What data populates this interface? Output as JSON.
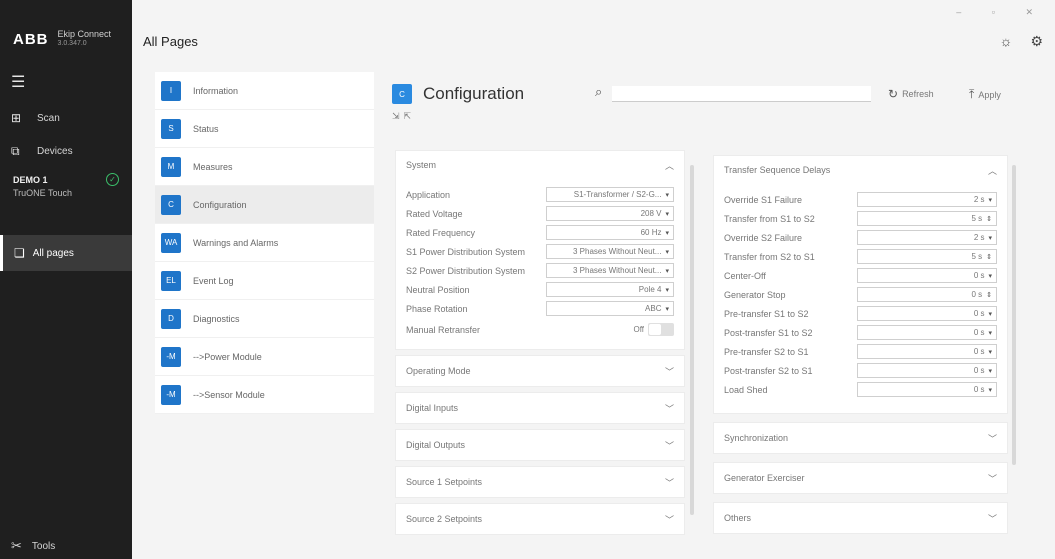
{
  "sidebar": {
    "brand": "ABB",
    "app_name": "Ekip Connect",
    "version": "3.0.347.0",
    "menu_icon": "hamburger-icon",
    "items": [
      {
        "label": "Scan",
        "icon": "scan-icon"
      },
      {
        "label": "Devices",
        "icon": "devices-icon"
      }
    ],
    "device": {
      "name": "DEMO 1",
      "model": "TruONE Touch",
      "status_icon": "check-circle-icon",
      "status_color": "#3bbf6a"
    },
    "active": {
      "label": "All pages",
      "icon": "pages-icon"
    },
    "tools": {
      "label": "Tools",
      "icon": "tools-icon"
    }
  },
  "header": {
    "title": "All Pages",
    "icons": [
      "lightbulb-icon",
      "gear-icon"
    ]
  },
  "pages": [
    {
      "badge": "I",
      "label": "Information"
    },
    {
      "badge": "S",
      "label": "Status"
    },
    {
      "badge": "M",
      "label": "Measures"
    },
    {
      "badge": "C",
      "label": "Configuration",
      "selected": true
    },
    {
      "badge": "WA",
      "label": "Warnings and Alarms"
    },
    {
      "badge": "EL",
      "label": "Event Log"
    },
    {
      "badge": "D",
      "label": "Diagnostics"
    },
    {
      "badge": "-M",
      "label": "-->Power Module"
    },
    {
      "badge": "-M",
      "label": "-->Sensor Module"
    }
  ],
  "config": {
    "badge": "C",
    "title": "Configuration",
    "search_placeholder": "",
    "refresh_label": "Refresh",
    "apply_label": "Apply",
    "accent": "#1f75c9"
  },
  "system": {
    "title": "System",
    "fields": [
      {
        "label": "Application",
        "value": "S1-Transformer / S2-G..."
      },
      {
        "label": "Rated Voltage",
        "value": "208 V"
      },
      {
        "label": "Rated Frequency",
        "value": "60 Hz"
      },
      {
        "label": "S1 Power Distribution System",
        "value": "3 Phases Without Neut..."
      },
      {
        "label": "S2 Power Distribution System",
        "value": "3 Phases Without Neut..."
      },
      {
        "label": "Neutral Position",
        "value": "Pole 4"
      },
      {
        "label": "Phase Rotation",
        "value": "ABC"
      }
    ],
    "manual_retransfer": {
      "label": "Manual Retransfer",
      "value": "Off"
    }
  },
  "left_sections": [
    "Operating Mode",
    "Digital Inputs",
    "Digital Outputs",
    "Source 1 Setpoints",
    "Source 2 Setpoints"
  ],
  "delays": {
    "title": "Transfer Sequence Delays",
    "fields": [
      {
        "label": "Override S1 Failure",
        "value": "2 s",
        "ctrl": "dropdown"
      },
      {
        "label": "Transfer from S1 to S2",
        "value": "5 s",
        "ctrl": "spinner"
      },
      {
        "label": "Override S2 Failure",
        "value": "2 s",
        "ctrl": "dropdown"
      },
      {
        "label": "Transfer from S2 to S1",
        "value": "5 s",
        "ctrl": "spinner"
      },
      {
        "label": "Center-Off",
        "value": "0 s",
        "ctrl": "dropdown"
      },
      {
        "label": "Generator Stop",
        "value": "0 s",
        "ctrl": "spinner"
      },
      {
        "label": "Pre-transfer S1 to S2",
        "value": "0 s",
        "ctrl": "dropdown"
      },
      {
        "label": "Post-transfer S1 to S2",
        "value": "0 s",
        "ctrl": "dropdown"
      },
      {
        "label": "Pre-transfer S2 to S1",
        "value": "0 s",
        "ctrl": "dropdown"
      },
      {
        "label": "Post-transfer S2 to S1",
        "value": "0 s",
        "ctrl": "dropdown"
      },
      {
        "label": "Load Shed",
        "value": "0 s",
        "ctrl": "dropdown"
      }
    ]
  },
  "right_sections": [
    "Synchronization",
    "Generator Exerciser",
    "Others"
  ]
}
